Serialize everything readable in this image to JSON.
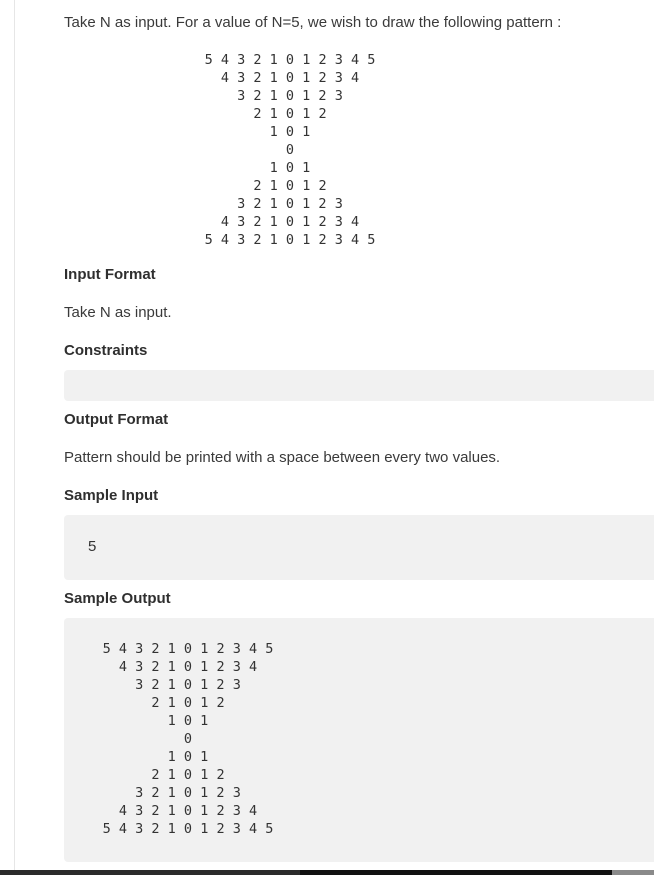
{
  "problem": {
    "intro": "Take N as input. For a value of N=5, we wish to draw the following pattern :",
    "pattern": "5 4 3 2 1 0 1 2 3 4 5\n4 3 2 1 0 1 2 3 4\n3 2 1 0 1 2 3\n2 1 0 1 2\n1 0 1\n0\n1 0 1\n2 1 0 1 2\n3 2 1 0 1 2 3\n4 3 2 1 0 1 2 3 4\n5 4 3 2 1 0 1 2 3 4 5"
  },
  "input_format": {
    "heading": "Input Format",
    "text": "Take N as input."
  },
  "constraints": {
    "heading": "Constraints",
    "text": ""
  },
  "output_format": {
    "heading": "Output Format",
    "text": "Pattern should be printed with a space between every two values."
  },
  "sample_input": {
    "heading": "Sample Input",
    "value": "5"
  },
  "sample_output": {
    "heading": "Sample Output",
    "value": "5 4 3 2 1 0 1 2 3 4 5\n4 3 2 1 0 1 2 3 4\n3 2 1 0 1 2 3\n2 1 0 1 2\n1 0 1\n0\n1 0 1\n2 1 0 1 2\n3 2 1 0 1 2 3\n4 3 2 1 0 1 2 3 4\n5 4 3 2 1 0 1 2 3 4 5"
  }
}
